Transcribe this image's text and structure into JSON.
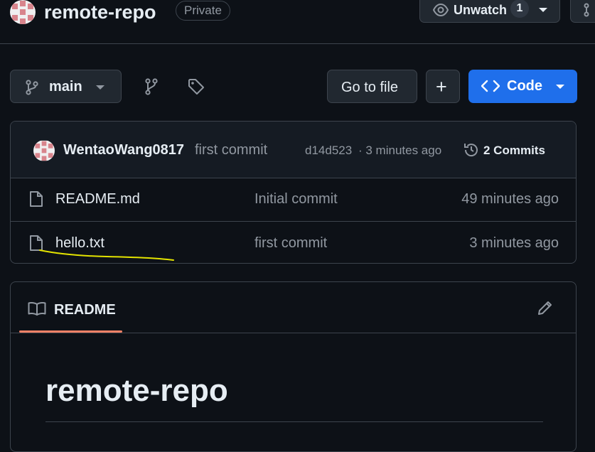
{
  "header": {
    "repo_name": "remote-repo",
    "visibility_badge": "Private",
    "unwatch_label": "Unwatch",
    "watch_count": "1"
  },
  "toolbar": {
    "branch": "main",
    "go_to_file_label": "Go to file",
    "add_label": "+",
    "code_label": "Code"
  },
  "latest_commit": {
    "author": "WentaoWang0817",
    "message": "first commit",
    "hash": "d14d523",
    "age": "· 3 minutes ago",
    "commits_label": "2 Commits"
  },
  "files": [
    {
      "name": "README.md",
      "message": "Initial commit",
      "age": "49 minutes ago"
    },
    {
      "name": "hello.txt",
      "message": "first commit",
      "age": "3 minutes ago"
    }
  ],
  "readme": {
    "tab_label": "README",
    "heading": "remote-repo"
  },
  "icons": {
    "repo_avatar": "identicon",
    "watch": "eye-icon",
    "branch": "git-branch-icon",
    "branches": "branches-icon",
    "tags": "tag-icon",
    "code": "code-icon",
    "history": "history-icon",
    "file": "file-icon",
    "book": "book-icon",
    "edit": "pencil-icon"
  },
  "colors": {
    "background": "#0d1117",
    "border": "#3d444d",
    "accent_blue": "#1f6feb",
    "tab_underline": "#f78166",
    "muted_text": "#9198a1",
    "highlight_scribble": "#e3e300"
  }
}
